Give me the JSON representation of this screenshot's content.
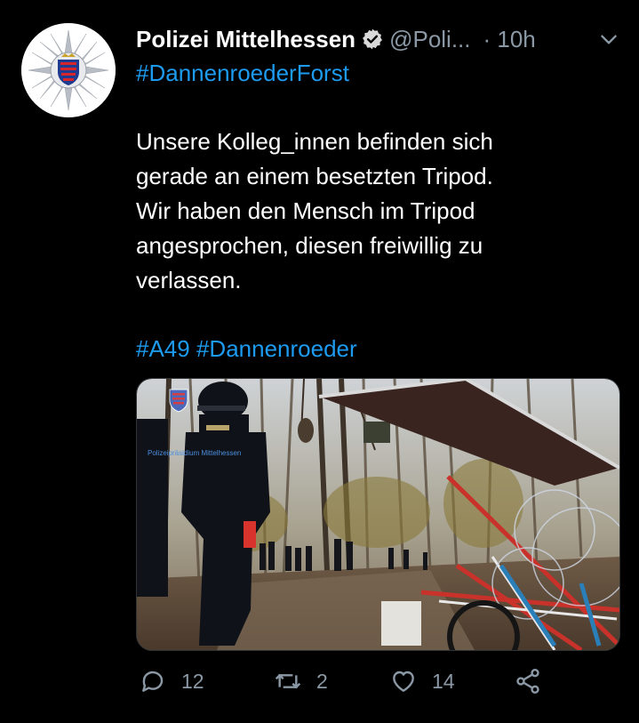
{
  "tweet": {
    "author_name": "Polizei Mittelhessen",
    "handle": "@Poli...",
    "time": "· 10h",
    "hashtag_top": "#DannenroederForst",
    "body_lines": [
      "Unsere Kolleg_innen befinden sich",
      "gerade an einem besetzten Tripod.",
      "Wir haben den Mensch im Tripod",
      "angesprochen, diesen freiwillig zu",
      "verlassen."
    ],
    "hashtags_bottom": [
      "#A49",
      "#Dannenroeder"
    ]
  },
  "actions": {
    "reply_count": "12",
    "retweet_count": "2",
    "like_count": "14"
  },
  "media": {
    "watermark": "Polizeipräsidium Mittelhessen"
  },
  "colors": {
    "background": "#000000",
    "link": "#1d9bf0",
    "muted": "#8b98a5"
  },
  "icons": [
    "verified-badge-icon",
    "chevron-down-icon",
    "reply-icon",
    "retweet-icon",
    "like-icon",
    "share-icon"
  ]
}
